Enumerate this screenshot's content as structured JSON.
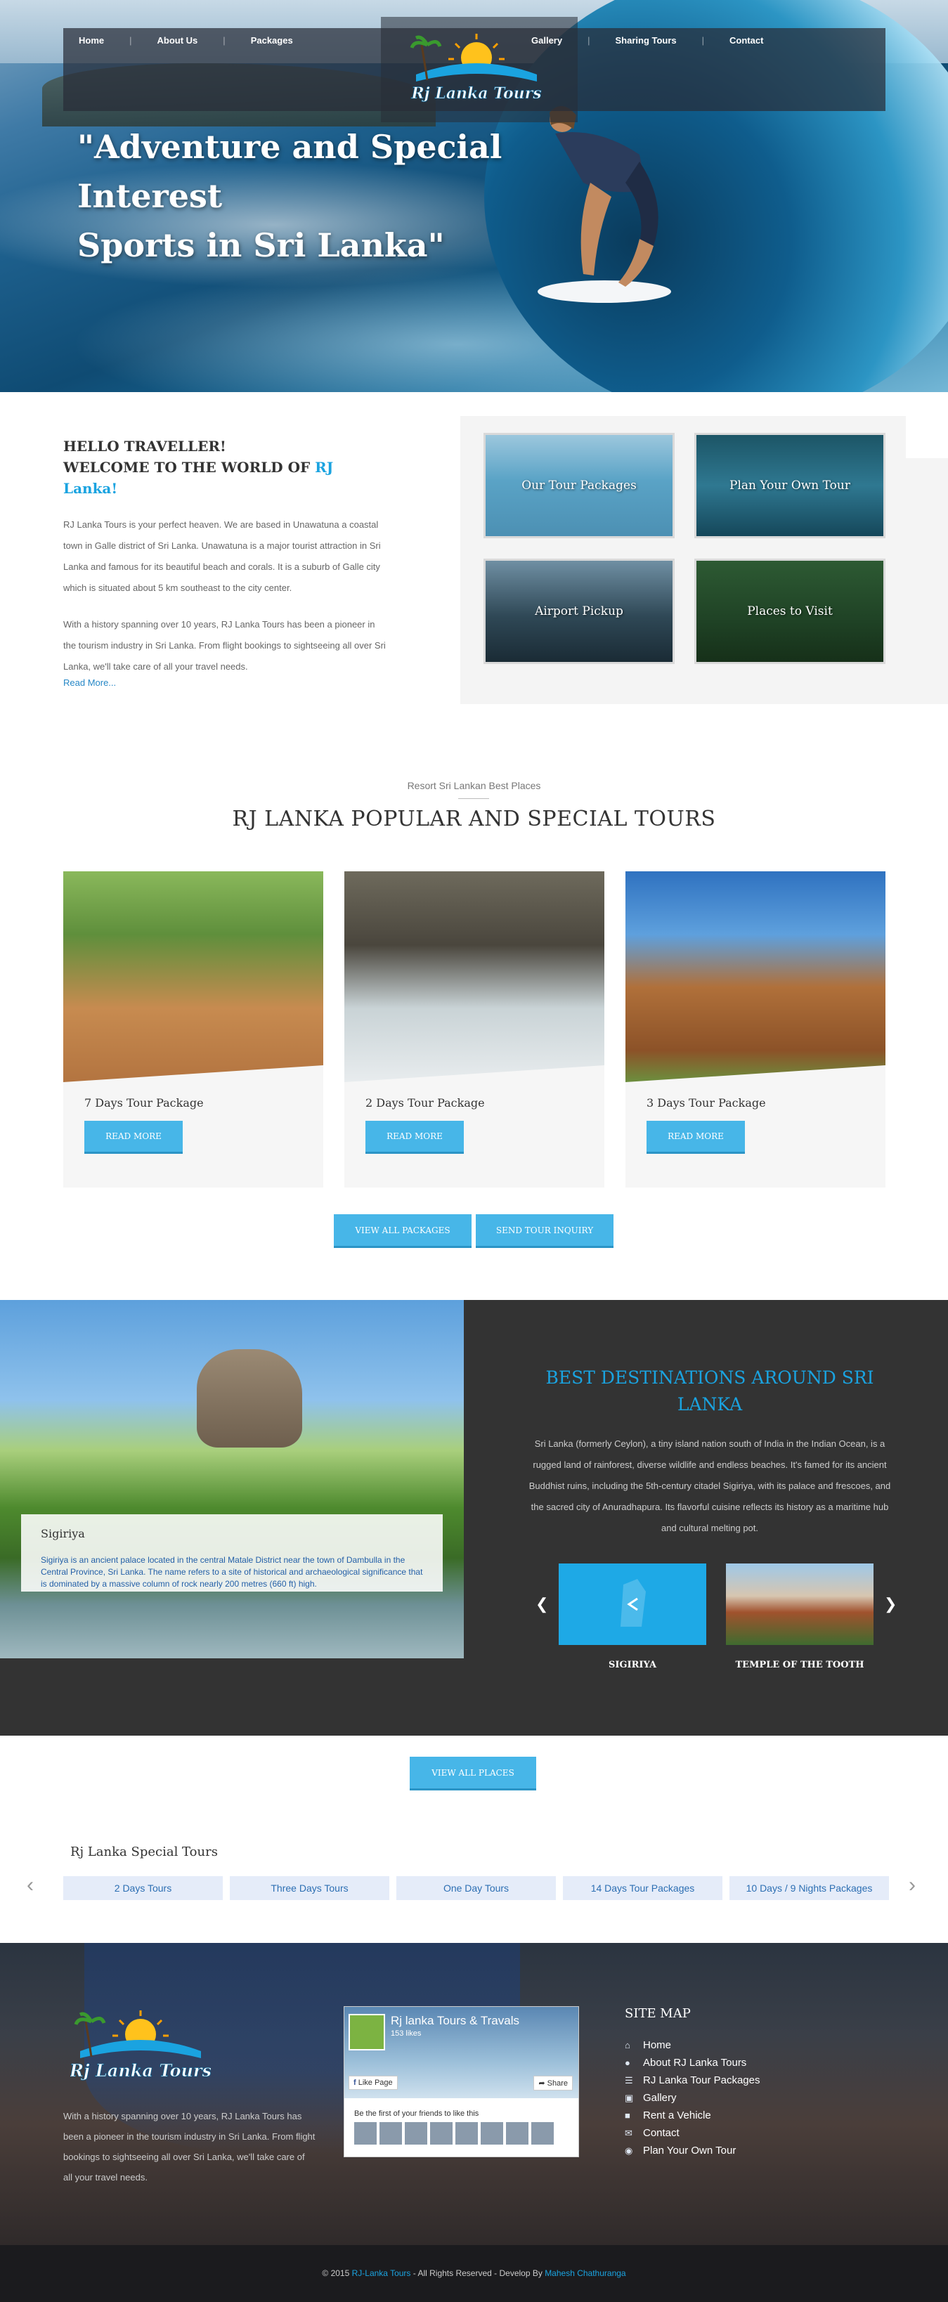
{
  "nav": {
    "left": [
      "Home",
      "About Us",
      "Packages"
    ],
    "right": [
      "Gallery",
      "Sharing Tours",
      "Contact"
    ],
    "logo_text": "Rj Lanka Tours"
  },
  "hero": {
    "line1": "\"Adventure and Special",
    "line2": "Interest",
    "line3": "Sports in Sri Lanka\""
  },
  "welcome": {
    "hello": "HELLO TRAVELLER!",
    "welcome_prefix": "WELCOME TO THE WORLD OF ",
    "welcome_highlight": "RJ Lanka!",
    "para1": "RJ Lanka Tours is your perfect heaven. We are based in Unawatuna a coastal town in Galle district of Sri Lanka. Unawatuna is a major tourist attraction in Sri Lanka and famous for its beautiful beach and corals. It is a suburb of Galle city which is situated about 5 km southeast to the city center.",
    "para2": "With a history spanning over 10 years, RJ Lanka Tours has been a pioneer in the tourism industry in Sri Lanka. From flight bookings to sightseeing all over Sri Lanka, we'll take care of all your travel needs.",
    "read_more": "Read More...",
    "services": [
      "Our Tour Packages",
      "Plan Your Own Tour",
      "Airport Pickup",
      "Places to Visit"
    ]
  },
  "tours": {
    "kicker": "Resort Sri Lankan Best Places",
    "title": "RJ LANKA POPULAR AND SPECIAL TOURS",
    "cards": [
      {
        "name": "7 Days Tour Package",
        "button": "READ MORE"
      },
      {
        "name": "2 Days Tour Package",
        "button": "READ MORE"
      },
      {
        "name": "3 Days Tour Package",
        "button": "READ MORE"
      }
    ],
    "view_all": "VIEW ALL PACKAGES",
    "inquiry": "SEND TOUR INQUIRY"
  },
  "destinations": {
    "title": "BEST DESTINATIONS AROUND SRI LANKA",
    "description": "Sri Lanka (formerly Ceylon), a tiny island nation south of India in the Indian Ocean, is a rugged land of rainforest, diverse wildlife and endless beaches. It's famed for its ancient Buddhist ruins, including the 5th-century citadel Sigiriya, with its palace and frescoes, and the sacred city of Anuradhapura. Its flavorful cuisine reflects its history as a maritime hub and cultural melting pot.",
    "caption_title": "Sigiriya",
    "caption_text": "Sigiriya is an ancient palace located in the central Matale District near the town of Dambulla in the Central Province, Sri Lanka. The name refers to a site of historical and archaeological significance that is dominated by a massive column of rock nearly 200 metres (660 ft) high.",
    "thumbs": [
      "SIGIRIYA",
      "TEMPLE OF THE TOOTH"
    ],
    "view_all": "VIEW ALL PLACES"
  },
  "special": {
    "title": "Rj Lanka Special Tours",
    "tabs": [
      "2 Days Tours",
      "Three Days Tours",
      "One Day Tours",
      "14 Days Tour Packages",
      "10 Days / 9 Nights Packages"
    ]
  },
  "footer": {
    "text": "With a history spanning over 10 years, RJ Lanka Tours has been a pioneer in the tourism industry in Sri Lanka. From flight bookings to sightseeing all over Sri Lanka, we'll take care of all your travel needs.",
    "fb_name": "Rj lanka Tours & Travals",
    "fb_likes": "153 likes",
    "fb_like": "Like Page",
    "fb_share": "Share",
    "fb_first": "Be the first of your friends to like this",
    "sitemap_title": "SITE MAP",
    "sitemap": [
      "Home",
      "About RJ Lanka Tours",
      "RJ Lanka Tour Packages",
      "Gallery",
      "Rent a Vehicle",
      "Contact",
      "Plan Your Own Tour"
    ],
    "copy_prefix": "© 2015 ",
    "copy_brand": "RJ-Lanka Tours",
    "copy_mid": " - All Rights Reserved - Develop By ",
    "copy_dev": "Mahesh Chathuranga"
  }
}
